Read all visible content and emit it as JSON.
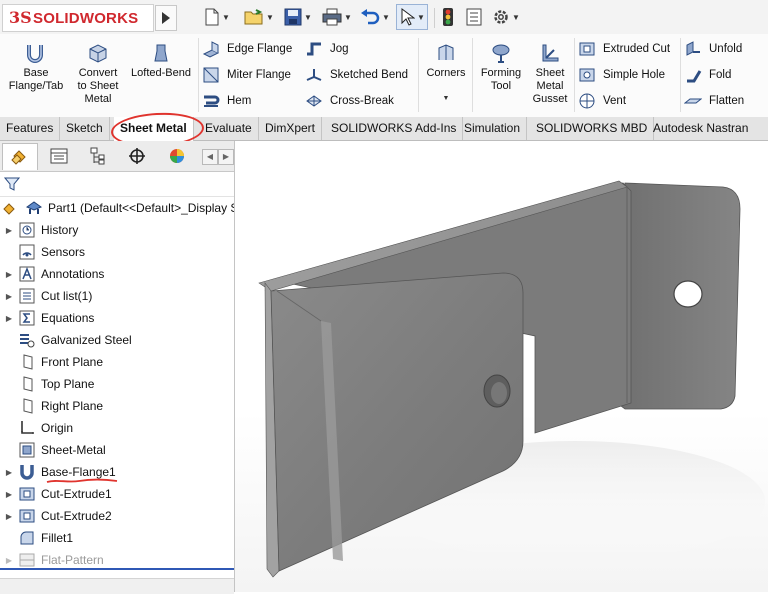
{
  "app": {
    "logo_prefix": "3S",
    "logo_name": "SOLIDWORKS"
  },
  "quick_access": {
    "icons": [
      "new-icon",
      "open-icon",
      "save-icon",
      "print-icon",
      "undo-icon",
      "select-icon",
      "traffic-light-icon",
      "file-properties-icon",
      "options-icon"
    ]
  },
  "ribbon": {
    "base_flange": "Base\nFlange/Tab",
    "convert": "Convert\nto Sheet\nMetal",
    "lofted_bend": "Lofted-Bend",
    "edge_flange": "Edge Flange",
    "miter_flange": "Miter Flange",
    "hem": "Hem",
    "jog": "Jog",
    "sketched_bend": "Sketched Bend",
    "cross_break": "Cross-Break",
    "corners": "Corners",
    "forming_tool": "Forming\nTool",
    "gusset": "Sheet\nMetal\nGusset",
    "extruded_cut": "Extruded Cut",
    "simple_hole": "Simple Hole",
    "vent": "Vent",
    "unfold": "Unfold",
    "fold": "Fold",
    "flatten": "Flatten"
  },
  "tabs": [
    {
      "label": "Features"
    },
    {
      "label": "Sketch"
    },
    {
      "label": "Sheet Metal"
    },
    {
      "label": "Evaluate"
    },
    {
      "label": "DimXpert"
    },
    {
      "label": "SOLIDWORKS Add-Ins"
    },
    {
      "label": "Simulation"
    },
    {
      "label": "SOLIDWORKS MBD"
    },
    {
      "label": "Autodesk Nastran In-C"
    }
  ],
  "tree": {
    "root": "Part1  (Default<<Default>_Display S",
    "items": [
      {
        "label": "History"
      },
      {
        "label": "Sensors"
      },
      {
        "label": "Annotations"
      },
      {
        "label": "Cut list(1)"
      },
      {
        "label": "Equations"
      },
      {
        "label": "Galvanized Steel"
      },
      {
        "label": "Front Plane"
      },
      {
        "label": "Top Plane"
      },
      {
        "label": "Right Plane"
      },
      {
        "label": "Origin"
      },
      {
        "label": "Sheet-Metal"
      },
      {
        "label": "Base-Flange1"
      },
      {
        "label": "Cut-Extrude1"
      },
      {
        "label": "Cut-Extrude2"
      },
      {
        "label": "Fillet1"
      },
      {
        "label": "Flat-Pattern"
      }
    ]
  },
  "colors": {
    "brand_red": "#d0282e",
    "annotation_red": "#e0342e",
    "selection_blue": "#2f58b5"
  }
}
